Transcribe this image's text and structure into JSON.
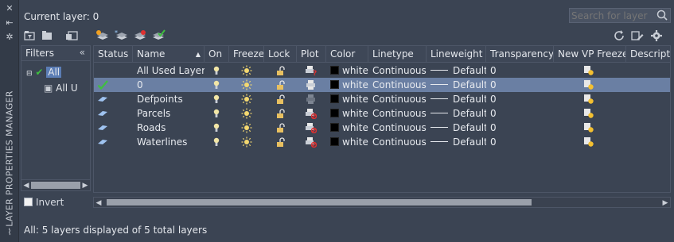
{
  "palette": {
    "title": "LAYER PROPERTIES MANAGER"
  },
  "header": {
    "current_layer": "Current layer: 0",
    "search_placeholder": "Search for layer"
  },
  "filters": {
    "title": "Filters",
    "tree": [
      {
        "label": "All",
        "selected": true
      },
      {
        "label": "All U",
        "selected": false
      }
    ],
    "invert_label": "Invert",
    "invert_checked": false
  },
  "grid": {
    "columns": [
      "Status",
      "Name",
      "On",
      "Freeze",
      "Lock",
      "Plot",
      "Color",
      "Linetype",
      "Lineweight",
      "Transparency",
      "New VP Freeze",
      "Descripti"
    ],
    "rows": [
      {
        "status": "",
        "name": "All Used Layers",
        "color": "white",
        "linetype": "Continuous",
        "lineweight": "Default",
        "transparency": "0",
        "plot": "mixed",
        "selected": false
      },
      {
        "status": "current",
        "name": "0",
        "color": "white",
        "linetype": "Continuous",
        "lineweight": "Default",
        "transparency": "0",
        "plot": "plot",
        "selected": true
      },
      {
        "status": "layer",
        "name": "Defpoints",
        "color": "white",
        "linetype": "Continuous",
        "lineweight": "Default",
        "transparency": "0",
        "plot": "noplot-gray",
        "selected": false
      },
      {
        "status": "layer",
        "name": "Parcels",
        "color": "white",
        "linetype": "Continuous",
        "lineweight": "Default",
        "transparency": "0",
        "plot": "noplot",
        "selected": false
      },
      {
        "status": "layer",
        "name": "Roads",
        "color": "white",
        "linetype": "Continuous",
        "lineweight": "Default",
        "transparency": "0",
        "plot": "noplot",
        "selected": false
      },
      {
        "status": "layer",
        "name": "Waterlines",
        "color": "white",
        "linetype": "Continuous",
        "lineweight": "Default",
        "transparency": "0",
        "plot": "noplot",
        "selected": false
      }
    ]
  },
  "status_bar": {
    "text": "All: 5 layers displayed of 5 total layers"
  },
  "colors": {
    "panel": "#3b4453",
    "selection": "#6a7fa3",
    "accent_check": "#3fbf3f"
  }
}
